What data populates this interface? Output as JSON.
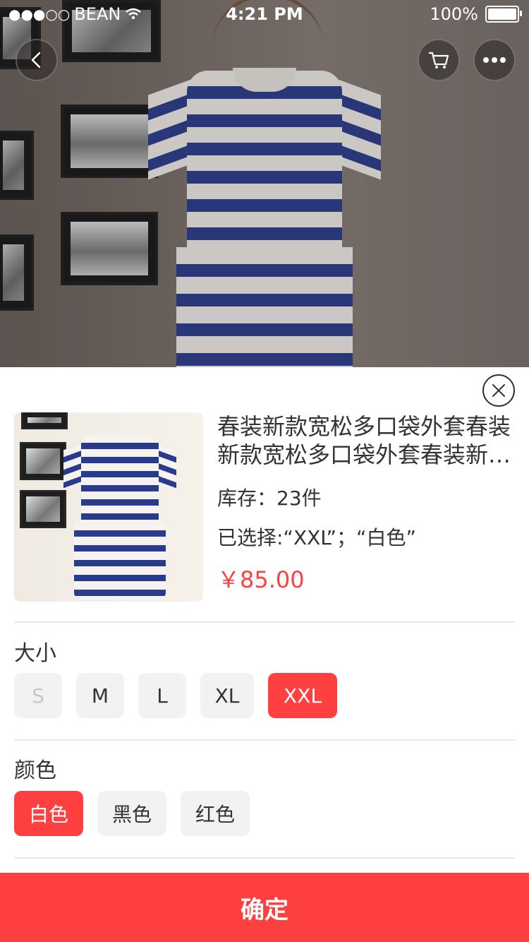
{
  "status_bar": {
    "carrier": "BEAN",
    "time": "4:21 PM",
    "battery": "100%"
  },
  "top_actions": {
    "back_icon": "chevron-left-icon",
    "cart_icon": "cart-icon",
    "more_icon": "more-icon"
  },
  "product": {
    "title": "春装新款宽松多口袋外套春装新款宽松多口袋外套春装新款宽松多口袋外套",
    "stock": "库存：23件",
    "selected": "已选择:“XXL”；“白色”",
    "price": "￥85.00"
  },
  "size": {
    "label": "大小",
    "options": [
      {
        "label": "S",
        "state": "disabled"
      },
      {
        "label": "M",
        "state": "normal"
      },
      {
        "label": "L",
        "state": "normal"
      },
      {
        "label": "XL",
        "state": "normal"
      },
      {
        "label": "XXL",
        "state": "selected"
      }
    ]
  },
  "color": {
    "label": "颜色",
    "options": [
      {
        "label": "白色",
        "state": "selected"
      },
      {
        "label": "黑色",
        "state": "normal"
      },
      {
        "label": "红色",
        "state": "normal"
      }
    ]
  },
  "confirm_label": "确定",
  "accent_color": "#ff4040"
}
